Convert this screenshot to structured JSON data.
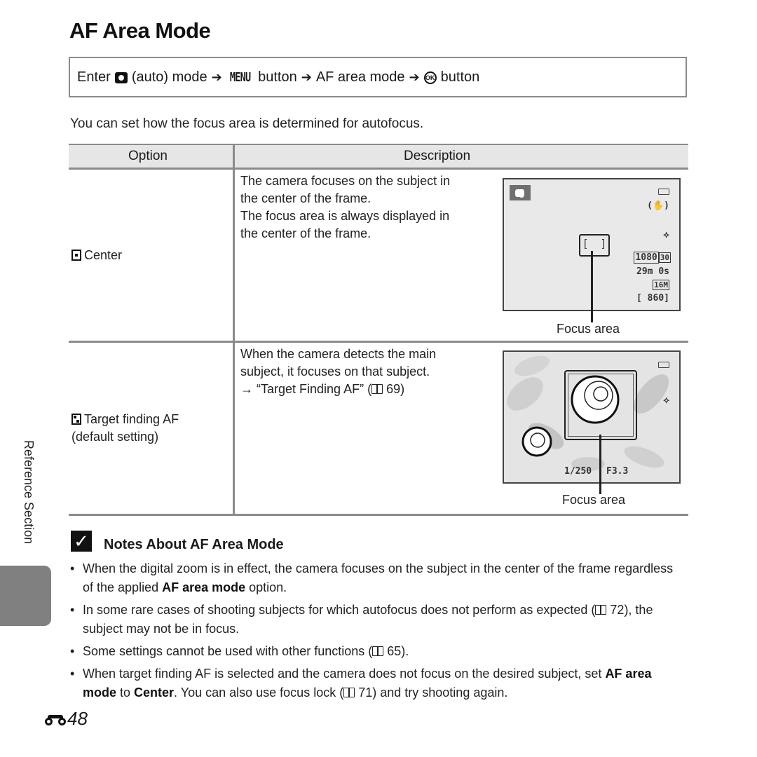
{
  "page": {
    "title": "AF Area Mode",
    "side_label": "Reference Section",
    "page_number": "48",
    "page_icon": "binoculars-icon"
  },
  "nav": {
    "enter": "Enter",
    "camera_icon": "camera-icon",
    "auto_mode": "(auto) mode",
    "arrow": "➔",
    "menu_glyph": "MENU",
    "button1": "button",
    "af_area_mode": "AF area mode",
    "ok_glyph": "OK",
    "button2": "button"
  },
  "intro": "You can set how the focus area is determined for autofocus.",
  "table": {
    "headers": [
      "Option",
      "Description"
    ],
    "rows": [
      {
        "option": "Center",
        "option_icon": "center-af-icon",
        "description_lines": [
          "The camera focuses on the subject in",
          "the center of the frame.",
          "The focus area is always displayed in",
          "the center of the frame."
        ],
        "screen": {
          "mode_icon": "camera-icon",
          "video_quality": "1080",
          "video_fps": "30",
          "remaining_time": "29m 0s",
          "image_size": "16M",
          "remaining_shots": "[ 860]",
          "focus_label": "Focus area"
        }
      },
      {
        "option": "Target finding AF",
        "option_sub": "(default setting)",
        "option_icon": "target-finding-af-icon",
        "description_lines": [
          "When the camera detects the main",
          "subject, it focuses on that subject."
        ],
        "ref_prefix": "→ “Target Finding AF” (",
        "ref_page": "69",
        "ref_suffix": ")",
        "screen": {
          "shutter": "1/250",
          "aperture": "F3.3",
          "focus_label": "Focus area"
        }
      }
    ]
  },
  "notes": {
    "title": "Notes About AF Area Mode",
    "items": [
      {
        "a": "When the digital zoom is in effect, the camera focuses on the subject in the center of the frame regardless of the applied ",
        "b": "AF area mode",
        "c": " option."
      },
      {
        "a": "In some rare cases of shooting subjects for which autofocus does not perform as expected (",
        "ref": "72",
        "c": "), the subject may not be in focus."
      },
      {
        "a": "Some settings cannot be used with other functions (",
        "ref": "65",
        "c": ")."
      },
      {
        "a": "When target finding AF is selected and the camera does not focus on the desired subject, set ",
        "b": "AF area mode",
        "c": " to ",
        "d": "Center",
        "e": ". You can also use focus lock (",
        "ref": "71",
        "f": ") and try shooting again."
      }
    ]
  }
}
